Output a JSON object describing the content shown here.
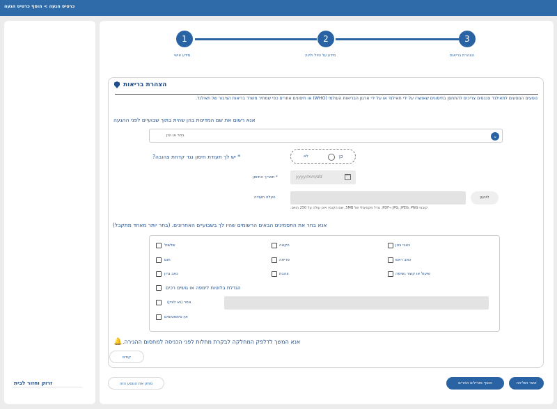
{
  "header": {
    "breadcrumb": "כרטיס הגעה > הוסף כרטיס הגעה"
  },
  "steps": [
    {
      "number": "1",
      "label": "מידע אישי"
    },
    {
      "number": "2",
      "label": "מידע על טיול ולינה"
    },
    {
      "number": "3",
      "label": "הצהרת בריאות"
    }
  ],
  "section": {
    "title": "הצהרת בריאות",
    "notice": "נוסעים הנוסעים לתאילנד ונכנסים צריכים להתחסן בחיסונים שאושרו על ידי תאילנד או על ידי ארגון הבריאות העולמי (WHO) או חיסונים אחרים כפי שמתיר משרד בריאות הציבור של תאילנד."
  },
  "countries": {
    "question": "אנא רשום את שם המדינות בהן שהית בתוך שבועיים לפני ההגעה",
    "placeholder": "בחר או הזן"
  },
  "vaccine": {
    "question": "* יש לך תעודת חיסון נגד קדחת צהובה?",
    "yes": "כן",
    "no": "לא",
    "date_label": "* תאריך החיסון",
    "date_placeholder": "yyyy/mm/dd",
    "upload_label": "העלה תעודה",
    "upload_button": "לטעון",
    "upload_hint": "קובצי JPG, JPEG, PNG ו-PDF, גודל מקסימלי של 5MB, שם הקובץ אינו עולה על 250 תווים."
  },
  "symptoms": {
    "question": "אנא בחר את התסמינים הבאים הרשומים שהיו לך בשבועיים האחרונים. (בחר יותר מאחד מתקבל)",
    "options": [
      "כאבי בטן",
      "הקאה",
      "שלשול",
      "כאב ראש",
      "פריחה",
      "חום",
      "שיעול או קוצר נשימה",
      "צהבת",
      "כאב גרון"
    ],
    "swollen": "הגדלת בלוטות לימפה או גושים רכים",
    "other": "אחר (נא לציין)",
    "none": "אין סימפטומים"
  },
  "notice2": "אנא המשך לדלפק המחלקה לבקרת מחלות לפני הכניסה למחסום ההגירה.",
  "buttons": {
    "back": "קודם",
    "add_more": "הוסף מטיילים אחרים",
    "preview": "אשר ושליחה",
    "delete": "מחק את הנוסע הזה",
    "reset": "זרוק וחזור לבית"
  }
}
